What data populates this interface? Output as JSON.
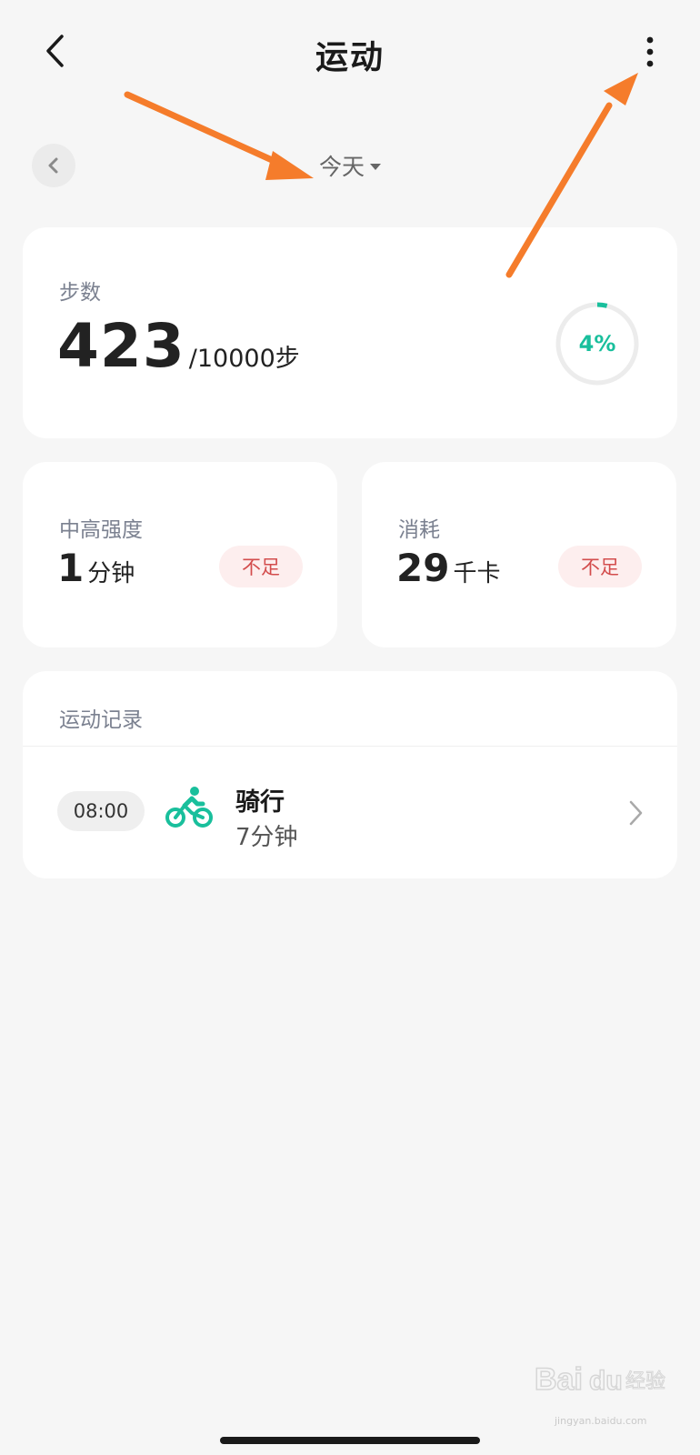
{
  "header": {
    "title": "运动"
  },
  "date_selector": {
    "label": "今天"
  },
  "steps_card": {
    "label": "步数",
    "value": "423",
    "goal": "/10000步",
    "progress_text": "4%",
    "progress_fraction": 0.04
  },
  "intensity_card": {
    "label": "中高强度",
    "value": "1",
    "unit": "分钟",
    "badge": "不足"
  },
  "calories_card": {
    "label": "消耗",
    "value": "29",
    "unit": "千卡",
    "badge": "不足"
  },
  "records": {
    "title": "运动记录",
    "items": [
      {
        "time": "08:00",
        "name": "骑行",
        "duration": "7分钟",
        "icon": "bicycle-icon"
      }
    ]
  },
  "watermark": {
    "text": "Bai du 经验",
    "url": "jingyan.baidu.com"
  },
  "colors": {
    "accent": "#19bf9c",
    "warning_text": "#d34d4d",
    "warning_bg": "#fdeeee",
    "annotation_arrow": "#f57c2b",
    "background": "#f6f6f6"
  }
}
